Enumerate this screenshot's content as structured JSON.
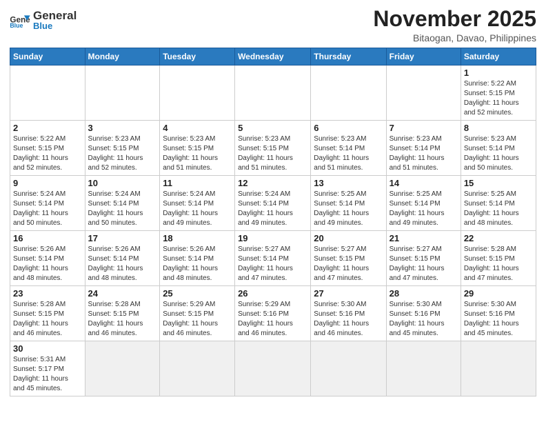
{
  "header": {
    "logo_general": "General",
    "logo_blue": "Blue",
    "month": "November 2025",
    "location": "Bitaogan, Davao, Philippines"
  },
  "days_of_week": [
    "Sunday",
    "Monday",
    "Tuesday",
    "Wednesday",
    "Thursday",
    "Friday",
    "Saturday"
  ],
  "weeks": [
    [
      {
        "day": "",
        "info": ""
      },
      {
        "day": "",
        "info": ""
      },
      {
        "day": "",
        "info": ""
      },
      {
        "day": "",
        "info": ""
      },
      {
        "day": "",
        "info": ""
      },
      {
        "day": "",
        "info": ""
      },
      {
        "day": "1",
        "info": "Sunrise: 5:22 AM\nSunset: 5:15 PM\nDaylight: 11 hours\nand 52 minutes."
      }
    ],
    [
      {
        "day": "2",
        "info": "Sunrise: 5:22 AM\nSunset: 5:15 PM\nDaylight: 11 hours\nand 52 minutes."
      },
      {
        "day": "3",
        "info": "Sunrise: 5:23 AM\nSunset: 5:15 PM\nDaylight: 11 hours\nand 52 minutes."
      },
      {
        "day": "4",
        "info": "Sunrise: 5:23 AM\nSunset: 5:15 PM\nDaylight: 11 hours\nand 51 minutes."
      },
      {
        "day": "5",
        "info": "Sunrise: 5:23 AM\nSunset: 5:15 PM\nDaylight: 11 hours\nand 51 minutes."
      },
      {
        "day": "6",
        "info": "Sunrise: 5:23 AM\nSunset: 5:14 PM\nDaylight: 11 hours\nand 51 minutes."
      },
      {
        "day": "7",
        "info": "Sunrise: 5:23 AM\nSunset: 5:14 PM\nDaylight: 11 hours\nand 51 minutes."
      },
      {
        "day": "8",
        "info": "Sunrise: 5:23 AM\nSunset: 5:14 PM\nDaylight: 11 hours\nand 50 minutes."
      }
    ],
    [
      {
        "day": "9",
        "info": "Sunrise: 5:24 AM\nSunset: 5:14 PM\nDaylight: 11 hours\nand 50 minutes."
      },
      {
        "day": "10",
        "info": "Sunrise: 5:24 AM\nSunset: 5:14 PM\nDaylight: 11 hours\nand 50 minutes."
      },
      {
        "day": "11",
        "info": "Sunrise: 5:24 AM\nSunset: 5:14 PM\nDaylight: 11 hours\nand 49 minutes."
      },
      {
        "day": "12",
        "info": "Sunrise: 5:24 AM\nSunset: 5:14 PM\nDaylight: 11 hours\nand 49 minutes."
      },
      {
        "day": "13",
        "info": "Sunrise: 5:25 AM\nSunset: 5:14 PM\nDaylight: 11 hours\nand 49 minutes."
      },
      {
        "day": "14",
        "info": "Sunrise: 5:25 AM\nSunset: 5:14 PM\nDaylight: 11 hours\nand 49 minutes."
      },
      {
        "day": "15",
        "info": "Sunrise: 5:25 AM\nSunset: 5:14 PM\nDaylight: 11 hours\nand 48 minutes."
      }
    ],
    [
      {
        "day": "16",
        "info": "Sunrise: 5:26 AM\nSunset: 5:14 PM\nDaylight: 11 hours\nand 48 minutes."
      },
      {
        "day": "17",
        "info": "Sunrise: 5:26 AM\nSunset: 5:14 PM\nDaylight: 11 hours\nand 48 minutes."
      },
      {
        "day": "18",
        "info": "Sunrise: 5:26 AM\nSunset: 5:14 PM\nDaylight: 11 hours\nand 48 minutes."
      },
      {
        "day": "19",
        "info": "Sunrise: 5:27 AM\nSunset: 5:14 PM\nDaylight: 11 hours\nand 47 minutes."
      },
      {
        "day": "20",
        "info": "Sunrise: 5:27 AM\nSunset: 5:15 PM\nDaylight: 11 hours\nand 47 minutes."
      },
      {
        "day": "21",
        "info": "Sunrise: 5:27 AM\nSunset: 5:15 PM\nDaylight: 11 hours\nand 47 minutes."
      },
      {
        "day": "22",
        "info": "Sunrise: 5:28 AM\nSunset: 5:15 PM\nDaylight: 11 hours\nand 47 minutes."
      }
    ],
    [
      {
        "day": "23",
        "info": "Sunrise: 5:28 AM\nSunset: 5:15 PM\nDaylight: 11 hours\nand 46 minutes."
      },
      {
        "day": "24",
        "info": "Sunrise: 5:28 AM\nSunset: 5:15 PM\nDaylight: 11 hours\nand 46 minutes."
      },
      {
        "day": "25",
        "info": "Sunrise: 5:29 AM\nSunset: 5:15 PM\nDaylight: 11 hours\nand 46 minutes."
      },
      {
        "day": "26",
        "info": "Sunrise: 5:29 AM\nSunset: 5:16 PM\nDaylight: 11 hours\nand 46 minutes."
      },
      {
        "day": "27",
        "info": "Sunrise: 5:30 AM\nSunset: 5:16 PM\nDaylight: 11 hours\nand 46 minutes."
      },
      {
        "day": "28",
        "info": "Sunrise: 5:30 AM\nSunset: 5:16 PM\nDaylight: 11 hours\nand 45 minutes."
      },
      {
        "day": "29",
        "info": "Sunrise: 5:30 AM\nSunset: 5:16 PM\nDaylight: 11 hours\nand 45 minutes."
      }
    ],
    [
      {
        "day": "30",
        "info": "Sunrise: 5:31 AM\nSunset: 5:17 PM\nDaylight: 11 hours\nand 45 minutes."
      },
      {
        "day": "",
        "info": ""
      },
      {
        "day": "",
        "info": ""
      },
      {
        "day": "",
        "info": ""
      },
      {
        "day": "",
        "info": ""
      },
      {
        "day": "",
        "info": ""
      },
      {
        "day": "",
        "info": ""
      }
    ]
  ]
}
